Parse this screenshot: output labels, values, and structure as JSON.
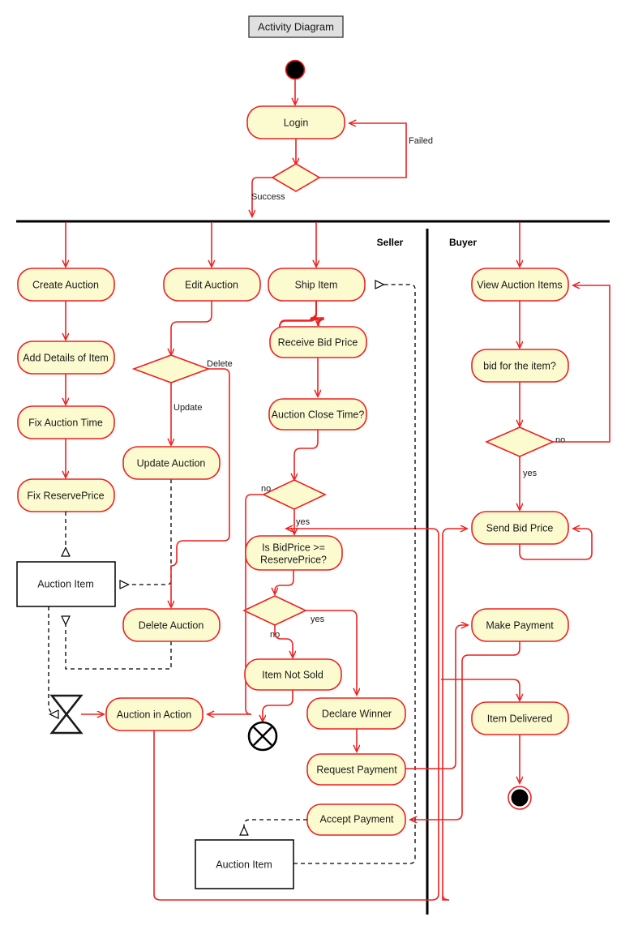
{
  "title": {
    "label": "Activity Diagram"
  },
  "lanes": [
    {
      "name": "lane-seller",
      "label": "Seller"
    },
    {
      "name": "lane-buyer",
      "label": "Buyer"
    }
  ],
  "nodes": {
    "initial": {
      "kind": "initial-node",
      "label": ""
    },
    "login": {
      "kind": "activity",
      "label": "Login"
    },
    "login_decision": {
      "kind": "decision",
      "label": ""
    },
    "create_auction": {
      "kind": "activity",
      "label": "Create Auction"
    },
    "add_details": {
      "kind": "activity",
      "label": "Add Details of Item"
    },
    "fix_auction_time": {
      "kind": "activity",
      "label": "Fix Auction Time"
    },
    "fix_reserve_price": {
      "kind": "activity",
      "label": "Fix ReservePrice"
    },
    "edit_auction": {
      "kind": "activity",
      "label": "Edit Auction"
    },
    "edit_decision": {
      "kind": "decision",
      "label": ""
    },
    "update_auction": {
      "kind": "activity",
      "label": "Update Auction"
    },
    "delete_auction": {
      "kind": "activity",
      "label": "Delete Auction"
    },
    "auction_item_left": {
      "kind": "object-node",
      "label": "Auction Item"
    },
    "auction_in_action": {
      "kind": "activity",
      "label": "Auction in Action"
    },
    "ship_item": {
      "kind": "activity",
      "label": "Ship Item"
    },
    "receive_bid_price": {
      "kind": "activity",
      "label": "Receive Bid Price"
    },
    "auction_close_time": {
      "kind": "activity",
      "label": "Auction Close Time?"
    },
    "close_decision": {
      "kind": "decision",
      "label": ""
    },
    "is_bidprice": {
      "kind": "activity",
      "label_line1": "Is BidPrice >=",
      "label_line2": "ReservePrice?"
    },
    "bid_decision": {
      "kind": "decision",
      "label": ""
    },
    "item_not_sold": {
      "kind": "activity",
      "label": "Item Not Sold"
    },
    "flow_final": {
      "kind": "flow-final-node",
      "label": ""
    },
    "declare_winner": {
      "kind": "activity",
      "label": "Declare Winner"
    },
    "request_payment": {
      "kind": "activity",
      "label": "Request Payment"
    },
    "accept_payment": {
      "kind": "activity",
      "label": "Accept Payment"
    },
    "auction_item_bottom": {
      "kind": "object-node",
      "label": "Auction Item"
    },
    "view_auction_items": {
      "kind": "activity",
      "label": "View Auction Items"
    },
    "bid_for_item": {
      "kind": "activity",
      "label": "bid for the item?"
    },
    "buyer_decision": {
      "kind": "decision",
      "label": ""
    },
    "send_bid_price": {
      "kind": "activity",
      "label": "Send Bid Price"
    },
    "make_payment": {
      "kind": "activity",
      "label": "Make Payment"
    },
    "item_delivered": {
      "kind": "activity",
      "label": "Item Delivered"
    },
    "final": {
      "kind": "final-node",
      "label": ""
    },
    "time_event": {
      "kind": "time-event-hourglass",
      "label": ""
    }
  },
  "edge_labels": {
    "failed": "Failed",
    "success": "Success",
    "delete": "Delete",
    "update": "Update",
    "close_no": "no",
    "close_yes": "yes",
    "bid_yes": "yes",
    "bid_no": "no",
    "buyer_no": "no",
    "buyer_yes": "yes"
  },
  "colors": {
    "activity_fill": "#fcfbd0",
    "activity_stroke": "#ef2020",
    "flow_stroke": "#ef2020",
    "dependency_stroke": "#000000",
    "lane_stroke": "#000000",
    "title_fill": "#e0e0e0",
    "object_fill": "#ffffff"
  }
}
